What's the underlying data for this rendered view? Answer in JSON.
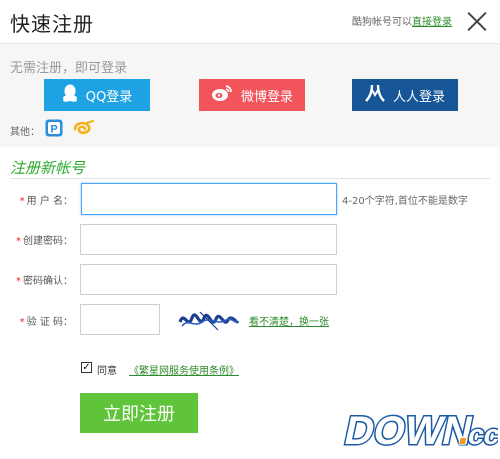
{
  "header": {
    "title": "快速注册",
    "hint_prefix": "酷狗帐号可以",
    "hint_link": "直接登录"
  },
  "social": {
    "heading": "无需注册，即可登录",
    "buttons": [
      {
        "label": "QQ登录",
        "icon": "qq-penguin-icon",
        "color": "#1fa2e3"
      },
      {
        "label": "微博登录",
        "icon": "weibo-icon",
        "color": "#f2545b"
      },
      {
        "label": "人人登录",
        "icon": "renren-icon",
        "color": "#165697"
      }
    ],
    "other_label": "其他：",
    "other_icons": [
      "passport-p-icon",
      "yellow-swirl-icon"
    ]
  },
  "register": {
    "heading": "注册新帐号",
    "fields": {
      "username": {
        "label": "用 户 名：",
        "value": "",
        "hint": "4-20个字符,首位不能是数字"
      },
      "password": {
        "label": "创建密码：",
        "value": ""
      },
      "confirm": {
        "label": "密码确认：",
        "value": ""
      },
      "captcha": {
        "label": "验 证 码：",
        "value": "",
        "refresh": "看不清楚，换一张"
      }
    },
    "agree": {
      "checked": true,
      "label": "同意",
      "terms": "《繁星网服务使用条例》"
    },
    "submit": "立即注册"
  },
  "watermark": "DOWN.cc",
  "colors": {
    "accent_green": "#5fc43a",
    "link_green": "#2c8b2c",
    "qq_blue": "#1fa2e3",
    "weibo_red": "#f2545b",
    "renren_navy": "#165697"
  }
}
